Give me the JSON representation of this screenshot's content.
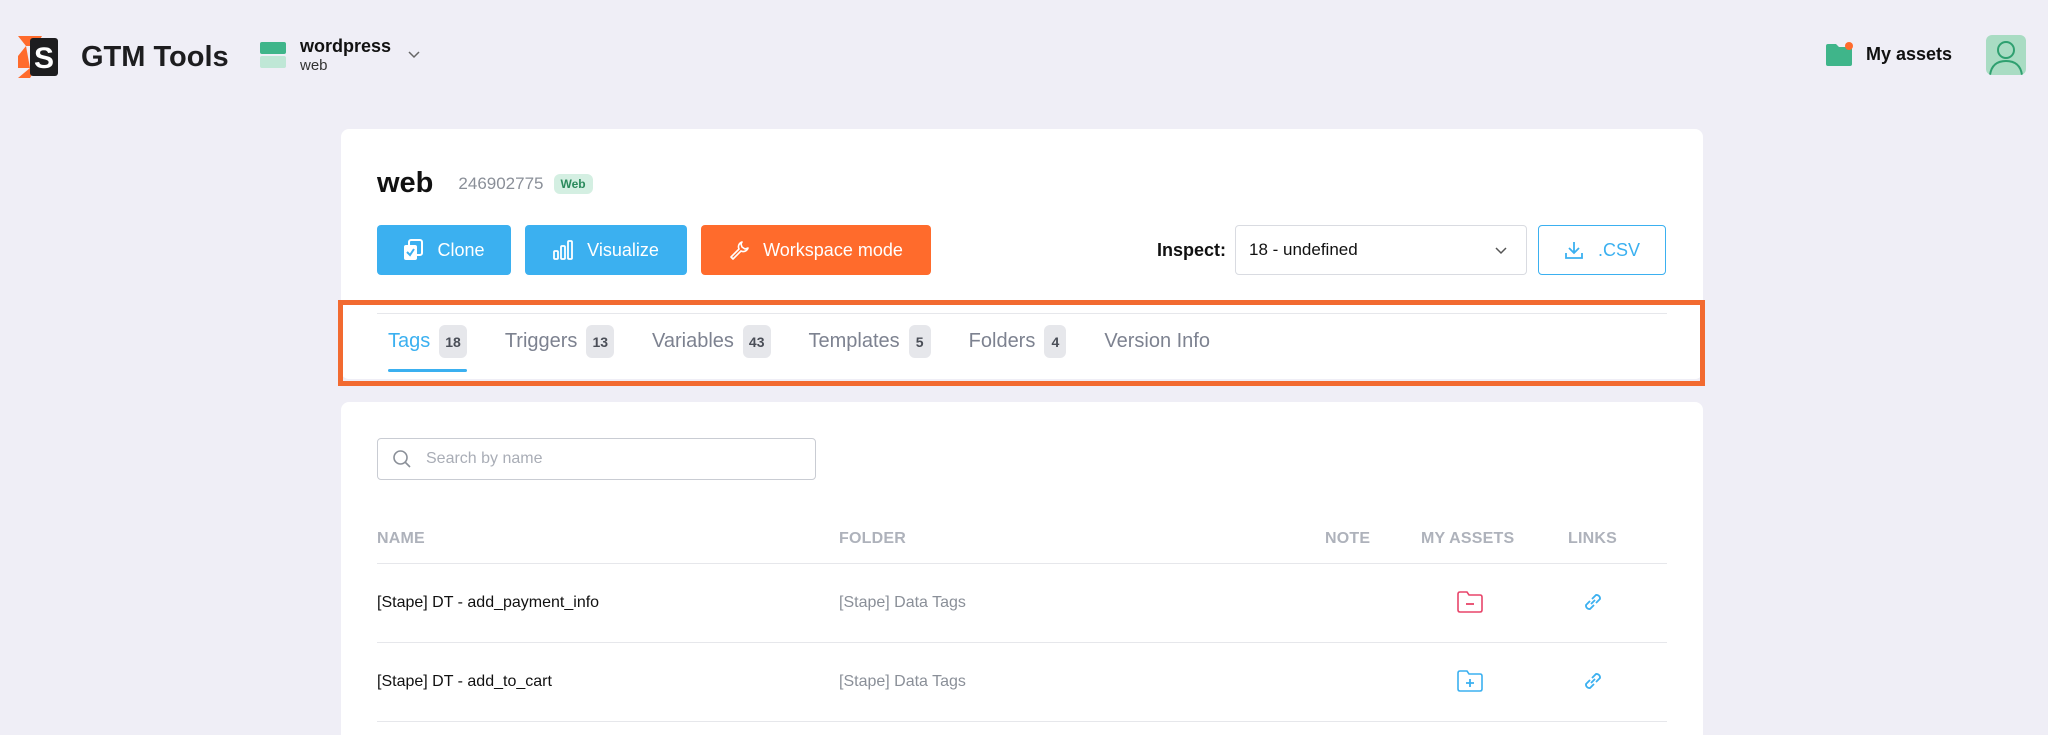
{
  "header": {
    "app_name": "GTM Tools",
    "container": {
      "name": "wordpress",
      "sub": "web"
    },
    "my_assets_label": "My assets"
  },
  "workspace": {
    "title": "web",
    "container_id": "246902775",
    "badge": "Web"
  },
  "actions": {
    "clone": "Clone",
    "visualize": "Visualize",
    "workspace_mode": "Workspace mode",
    "inspect_label": "Inspect:",
    "inspect_value": "18 - undefined",
    "csv": ".CSV"
  },
  "tabs": [
    {
      "label": "Tags",
      "count": "18"
    },
    {
      "label": "Triggers",
      "count": "13"
    },
    {
      "label": "Variables",
      "count": "43"
    },
    {
      "label": "Templates",
      "count": "5"
    },
    {
      "label": "Folders",
      "count": "4"
    },
    {
      "label": "Version Info"
    }
  ],
  "search": {
    "placeholder": "Search by name"
  },
  "table": {
    "headers": {
      "name": "NAME",
      "folder": "FOLDER",
      "note": "NOTE",
      "my_assets": "MY ASSETS",
      "links": "LINKS"
    },
    "rows": [
      {
        "name": "[Stape] DT - add_payment_info",
        "folder": "[Stape] Data Tags",
        "asset_icon": "folder-minus-icon"
      },
      {
        "name": "[Stape] DT - add_to_cart",
        "folder": "[Stape] Data Tags",
        "asset_icon": "folder-plus-icon"
      }
    ]
  },
  "colors": {
    "accent": "#3bb0f0",
    "workspace": "#ff6b2c",
    "highlight": "#f26a30",
    "remove": "#e8456a"
  }
}
